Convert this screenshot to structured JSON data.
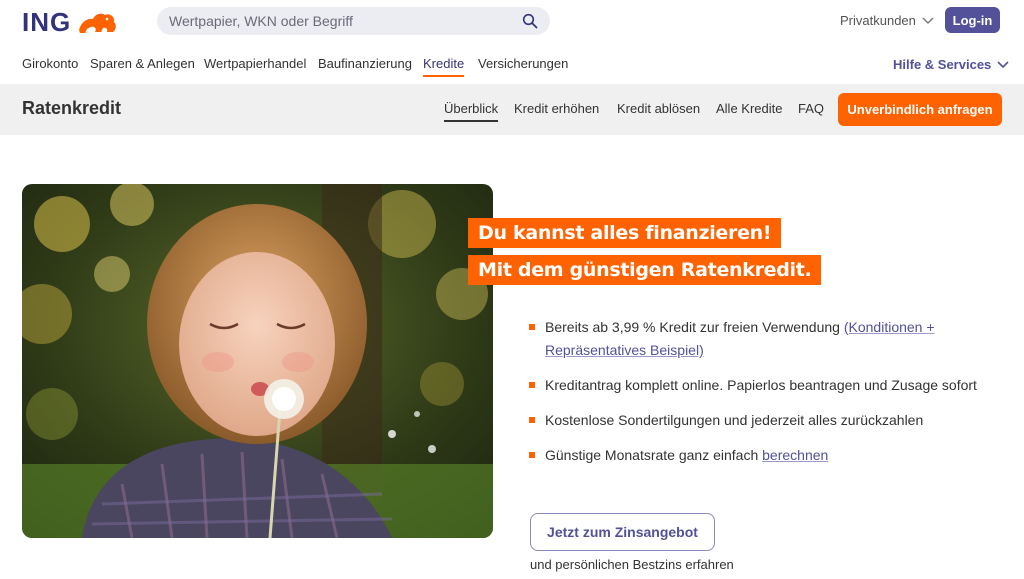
{
  "header": {
    "logo_text": "ING",
    "search_placeholder": "Wertpapier, WKN oder Begriff",
    "segment_label": "Privatkunden",
    "login_label": "Log-in"
  },
  "main_nav": {
    "items": [
      {
        "label": "Girokonto"
      },
      {
        "label": "Sparen & Anlegen"
      },
      {
        "label": "Wertpapierhandel"
      },
      {
        "label": "Baufinanzierung"
      },
      {
        "label": "Kredite"
      },
      {
        "label": "Versicherungen"
      }
    ],
    "help_label": "Hilfe & Services"
  },
  "sub_nav": {
    "title": "Ratenkredit",
    "items": [
      {
        "label": "Überblick"
      },
      {
        "label": "Kredit erhöhen"
      },
      {
        "label": "Kredit ablösen"
      },
      {
        "label": "Alle Kredite"
      },
      {
        "label": "FAQ"
      }
    ],
    "cta_label": "Unverbindlich anfragen"
  },
  "hero": {
    "headline_line1": "Du kannst alles finanzieren!",
    "headline_line2": "Mit dem günstigen Ratenkredit.",
    "bullets": {
      "b1_text": "Bereits ab 3,99 % Kredit zur freien Verwendung ",
      "b1_link": "(Konditionen + Repräsentatives Beispiel)",
      "b2_text": "Kreditantrag komplett online. Papierlos beantragen und Zusage sofort",
      "b3_text": "Kostenlose Sondertilgungen und jederzeit alles zurückzahlen",
      "b4_text": "Günstige Monatsrate ganz einfach ",
      "b4_link": "berechnen"
    },
    "offer_button": "Jetzt zum Zinsangebot",
    "offer_sub": "und persönlichen Bestzins erfahren"
  },
  "colors": {
    "brand_orange": "#ff6200",
    "brand_purple": "#525199",
    "logo_navy": "#33337d",
    "subnav_bg": "#f0f0f0"
  }
}
